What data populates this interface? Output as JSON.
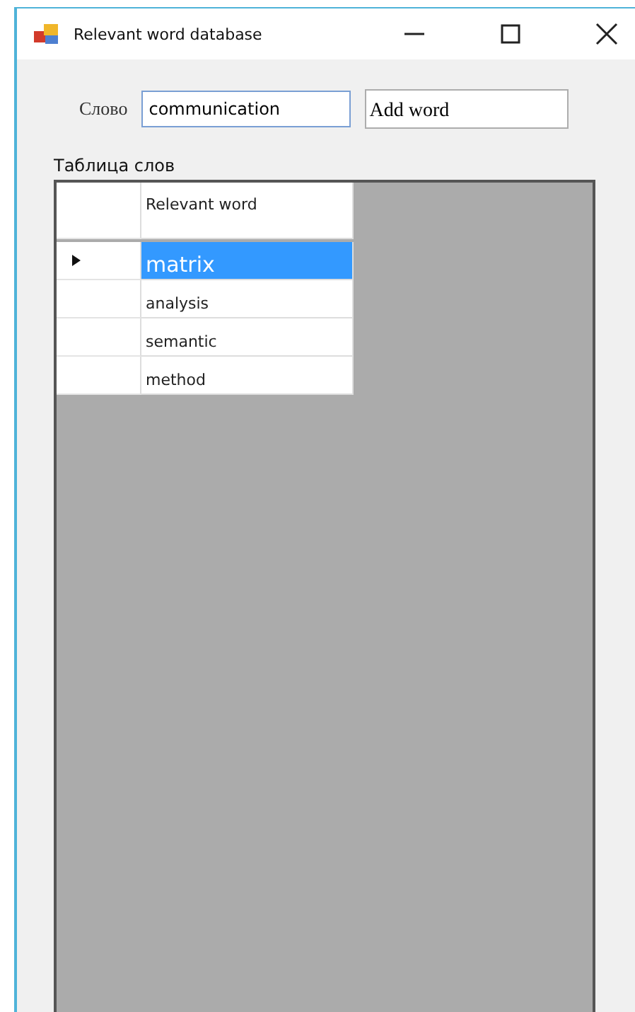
{
  "window": {
    "title": "Relevant word database"
  },
  "word_field": {
    "label": "Слово",
    "value": "communication"
  },
  "add_button": {
    "label": "Add word"
  },
  "table": {
    "caption": "Таблица слов",
    "columns": [
      "Relevant word"
    ],
    "rows": [
      {
        "text": "matrix",
        "selected": true
      },
      {
        "text": "analysis",
        "selected": false
      },
      {
        "text": "semantic",
        "selected": false
      },
      {
        "text": "method",
        "selected": false
      }
    ]
  }
}
